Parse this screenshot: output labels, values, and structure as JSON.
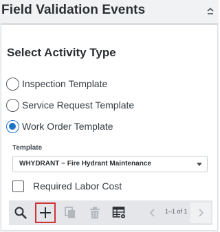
{
  "header": {
    "title": "Field Validation Events",
    "collapse_icon": "chevron-up-icon"
  },
  "section": {
    "title": "Select Activity Type"
  },
  "activity_types": [
    {
      "label": "Inspection Template",
      "checked": false
    },
    {
      "label": "Service Request Template",
      "checked": false
    },
    {
      "label": "Work Order Template",
      "checked": true
    }
  ],
  "template_field": {
    "label": "Template",
    "value": "WHYDRANT ~ Fire Hydrant Maintenance"
  },
  "required_labor_cost": {
    "label": "Required Labor Cost",
    "checked": false
  },
  "toolbar": {
    "icons": [
      "search-icon",
      "add-icon",
      "copy-icon",
      "delete-icon",
      "grid-settings-icon"
    ],
    "pager_text": "1–1 of 1"
  },
  "colors": {
    "accent": "#1a73c9",
    "active_outline": "#d13438",
    "toolbar_bg": "#e4e6e9",
    "disabled_icon": "#b3b8bd"
  }
}
